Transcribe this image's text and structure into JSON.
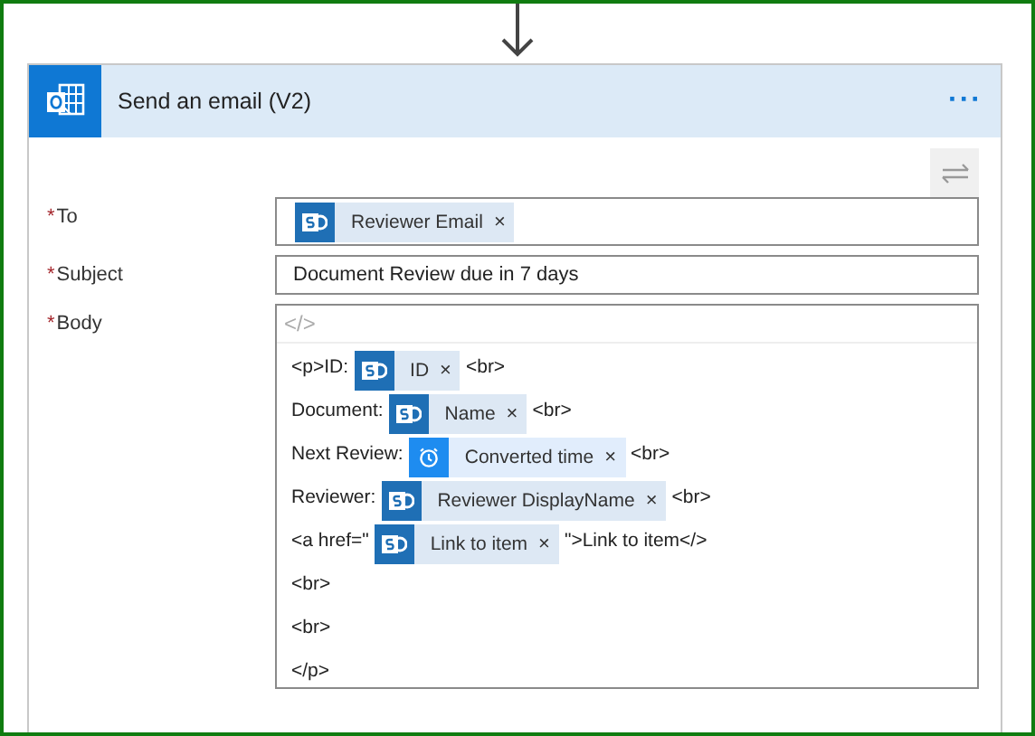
{
  "card": {
    "title": "Send an email (V2)",
    "menu": "···"
  },
  "required_mark": "*",
  "fields": [
    {
      "label": "To",
      "required": true,
      "kind": "tokens",
      "tokens": [
        {
          "kind": "sharepoint",
          "text": "Reviewer Email",
          "remove": "×"
        }
      ]
    },
    {
      "label": "Subject",
      "required": true,
      "kind": "text",
      "value": "Document Review due in 7 days"
    },
    {
      "label": "Body",
      "required": true,
      "kind": "html",
      "toolbar": "</>",
      "lines": [
        [
          {
            "kind": "text",
            "text": "<p>ID:"
          },
          {
            "kind": "sharepoint",
            "text": "ID",
            "remove": "×"
          },
          {
            "kind": "text",
            "text": "<br>"
          }
        ],
        [
          {
            "kind": "text",
            "text": "Document:"
          },
          {
            "kind": "sharepoint",
            "text": "Name",
            "remove": "×"
          },
          {
            "kind": "text",
            "text": "<br>"
          }
        ],
        [
          {
            "kind": "text",
            "text": "Next Review:"
          },
          {
            "kind": "clock",
            "text": "Converted time",
            "remove": "×"
          },
          {
            "kind": "text",
            "text": "<br>"
          }
        ],
        [
          {
            "kind": "text",
            "text": "Reviewer:"
          },
          {
            "kind": "sharepoint",
            "text": "Reviewer DisplayName",
            "remove": "×"
          },
          {
            "kind": "text",
            "text": "<br>"
          }
        ],
        [
          {
            "kind": "text",
            "text": "<a href=\""
          },
          {
            "kind": "sharepoint",
            "text": "Link to item",
            "remove": "×"
          },
          {
            "kind": "text",
            "text": "\">Link to item</>"
          }
        ],
        [
          {
            "kind": "text",
            "text": "<br>"
          }
        ],
        [
          {
            "kind": "text",
            "text": "<br>"
          }
        ],
        [
          {
            "kind": "text",
            "text": "</p>"
          }
        ]
      ]
    }
  ]
}
